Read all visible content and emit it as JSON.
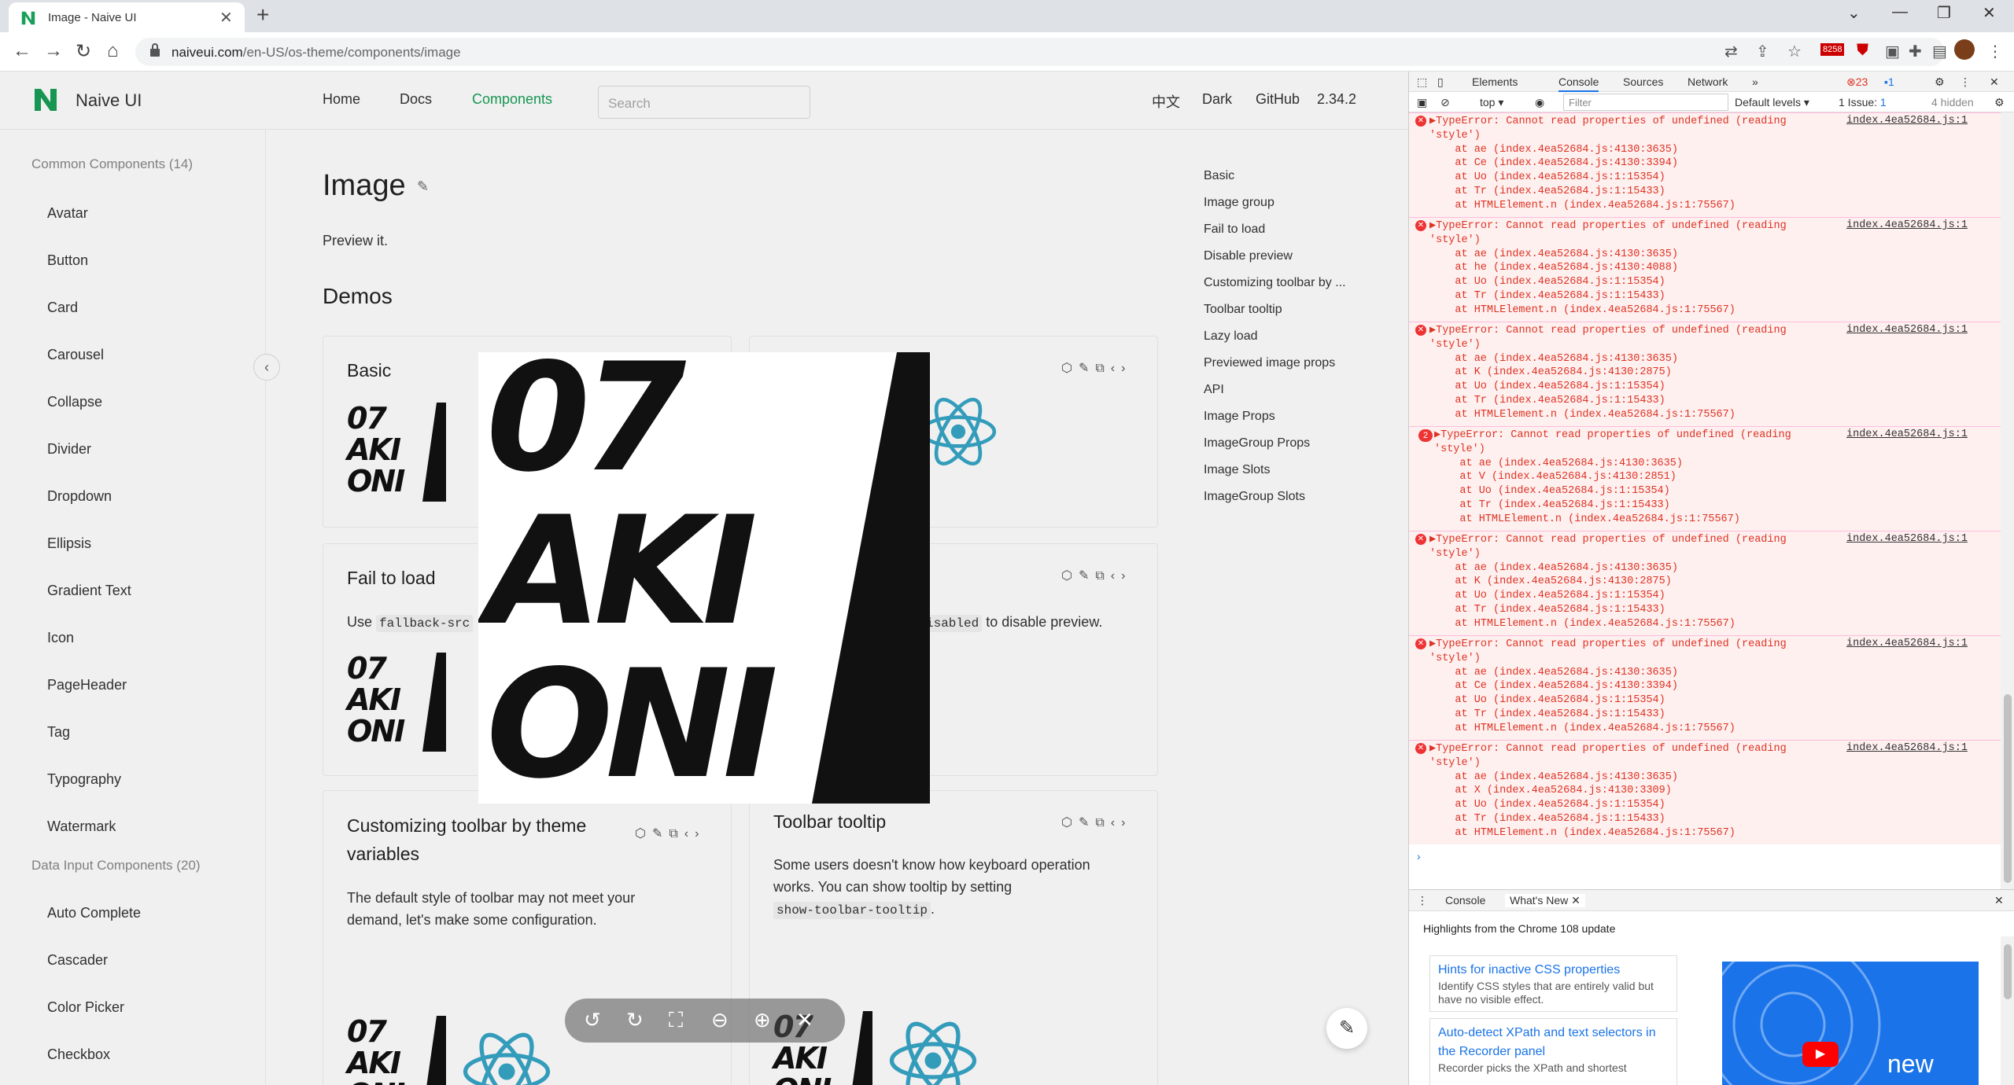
{
  "browser": {
    "tab_title": "Image - Naive UI",
    "url_host": "naiveui.com",
    "url_path": "/en-US/os-theme/components/image",
    "ext_badge": "8258"
  },
  "site": {
    "brand": "Naive UI",
    "nav": [
      "Home",
      "Docs",
      "Components"
    ],
    "search_placeholder": "Search",
    "lang": "中文",
    "theme": "Dark",
    "github": "GitHub",
    "version": "2.34.2"
  },
  "sidebar": {
    "group1": "Common Components (14)",
    "items1": [
      "Avatar",
      "Button",
      "Card",
      "Carousel",
      "Collapse",
      "Divider",
      "Dropdown",
      "Ellipsis",
      "Gradient Text",
      "Icon",
      "PageHeader",
      "Tag",
      "Typography",
      "Watermark"
    ],
    "group2": "Data Input Components (20)",
    "items2": [
      "Auto Complete",
      "Cascader",
      "Color Picker",
      "Checkbox"
    ]
  },
  "content": {
    "title": "Image",
    "desc": "Preview it.",
    "demos": "Demos",
    "card_basic": "Basic",
    "card_fail": "Fail to load",
    "fail_text_1": "Use",
    "fail_code": "fallback-src",
    "disabled_code": "isabled",
    "disabled_text": "to disable preview.",
    "card_custom": "Customizing toolbar by theme variables",
    "custom_text": "The default style of toolbar may not meet your demand, let's make some configuration.",
    "card_tooltip": "Toolbar tooltip",
    "tooltip_text": "Some users doesn't know how keyboard operation works. You can show tooltip by setting",
    "tooltip_code": "show-toolbar-tooltip",
    "tooltip_end": ".",
    "thumb_text": [
      "07",
      "AKI",
      "ONI"
    ]
  },
  "anchors": [
    "Basic",
    "Image group",
    "Fail to load",
    "Disable preview",
    "Customizing toolbar by ...",
    "Toolbar tooltip",
    "Lazy load",
    "Previewed image props",
    "API",
    "Image Props",
    "ImageGroup Props",
    "Image Slots",
    "ImageGroup Slots"
  ],
  "devtools": {
    "tabs": [
      "Elements",
      "Console",
      "Sources",
      "Network"
    ],
    "errors_count": "23",
    "messages_count": "1",
    "context": "top",
    "filter_placeholder": "Filter",
    "levels": "Default levels",
    "issues": "1 Issue:",
    "issues_count": "1",
    "hidden": "4 hidden",
    "source": "index.4ea52684.js:1",
    "errors": [
      {
        "count": "",
        "text": "▶TypeError: Cannot read properties of undefined (reading\n'style')\n    at ae (index.4ea52684.js:4130:3635)\n    at Ce (index.4ea52684.js:4130:3394)\n    at Uo (index.4ea52684.js:1:15354)\n    at Tr (index.4ea52684.js:1:15433)\n    at HTMLElement.n (index.4ea52684.js:1:75567)"
      },
      {
        "count": "",
        "text": "▶TypeError: Cannot read properties of undefined (reading\n'style')\n    at ae (index.4ea52684.js:4130:3635)\n    at he (index.4ea52684.js:4130:4088)\n    at Uo (index.4ea52684.js:1:15354)\n    at Tr (index.4ea52684.js:1:15433)\n    at HTMLElement.n (index.4ea52684.js:1:75567)"
      },
      {
        "count": "",
        "text": "▶TypeError: Cannot read properties of undefined (reading\n'style')\n    at ae (index.4ea52684.js:4130:3635)\n    at K (index.4ea52684.js:4130:2875)\n    at Uo (index.4ea52684.js:1:15354)\n    at Tr (index.4ea52684.js:1:15433)\n    at HTMLElement.n (index.4ea52684.js:1:75567)"
      },
      {
        "count": "2",
        "text": "▶TypeError: Cannot read properties of undefined (reading\n'style')\n    at ae (index.4ea52684.js:4130:3635)\n    at V (index.4ea52684.js:4130:2851)\n    at Uo (index.4ea52684.js:1:15354)\n    at Tr (index.4ea52684.js:1:15433)\n    at HTMLElement.n (index.4ea52684.js:1:75567)"
      },
      {
        "count": "",
        "text": "▶TypeError: Cannot read properties of undefined (reading\n'style')\n    at ae (index.4ea52684.js:4130:3635)\n    at K (index.4ea52684.js:4130:2875)\n    at Uo (index.4ea52684.js:1:15354)\n    at Tr (index.4ea52684.js:1:15433)\n    at HTMLElement.n (index.4ea52684.js:1:75567)"
      },
      {
        "count": "",
        "text": "▶TypeError: Cannot read properties of undefined (reading\n'style')\n    at ae (index.4ea52684.js:4130:3635)\n    at Ce (index.4ea52684.js:4130:3394)\n    at Uo (index.4ea52684.js:1:15354)\n    at Tr (index.4ea52684.js:1:15433)\n    at HTMLElement.n (index.4ea52684.js:1:75567)"
      },
      {
        "count": "",
        "text": "▶TypeError: Cannot read properties of undefined (reading\n'style')\n    at ae (index.4ea52684.js:4130:3635)\n    at X (index.4ea52684.js:4130:3309)\n    at Uo (index.4ea52684.js:1:15354)\n    at Tr (index.4ea52684.js:1:15433)\n    at HTMLElement.n (index.4ea52684.js:1:75567)"
      }
    ],
    "drawer_tabs": [
      "Console",
      "What's New"
    ],
    "whatsnew_head": "Highlights from the Chrome 108 update",
    "wn1_title": "Hints for inactive CSS properties",
    "wn1_text": "Identify CSS styles that are entirely valid but have no visible effect.",
    "wn2_title": "Auto-detect XPath and text selectors in the Recorder panel",
    "wn2_text": "Recorder picks the XPath and shortest",
    "wn_img_text": "new"
  },
  "colors": {
    "accent": "#18a058",
    "error": "#d32f2f",
    "link": "#1a73e8"
  }
}
